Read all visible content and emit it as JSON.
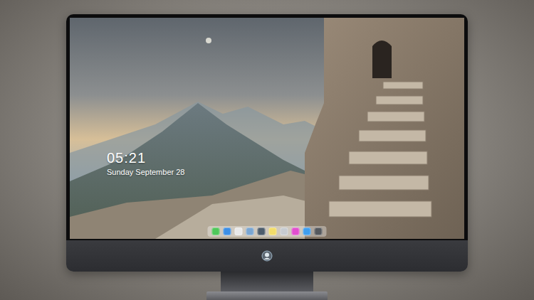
{
  "lock_screen": {
    "time": "05:21",
    "date": "Sunday September 28"
  },
  "dock": {
    "apps": [
      {
        "color": "#4fc85a"
      },
      {
        "color": "#3d8fe6"
      },
      {
        "color": "#e9e9e9"
      },
      {
        "color": "#7aa6d2"
      },
      {
        "color": "#4e5d6c"
      },
      {
        "color": "#f3dd6a"
      },
      {
        "color": "#c7cbd0"
      },
      {
        "color": "#e24fcf"
      },
      {
        "color": "#3f9ff0"
      },
      {
        "color": "#55595e"
      }
    ]
  }
}
